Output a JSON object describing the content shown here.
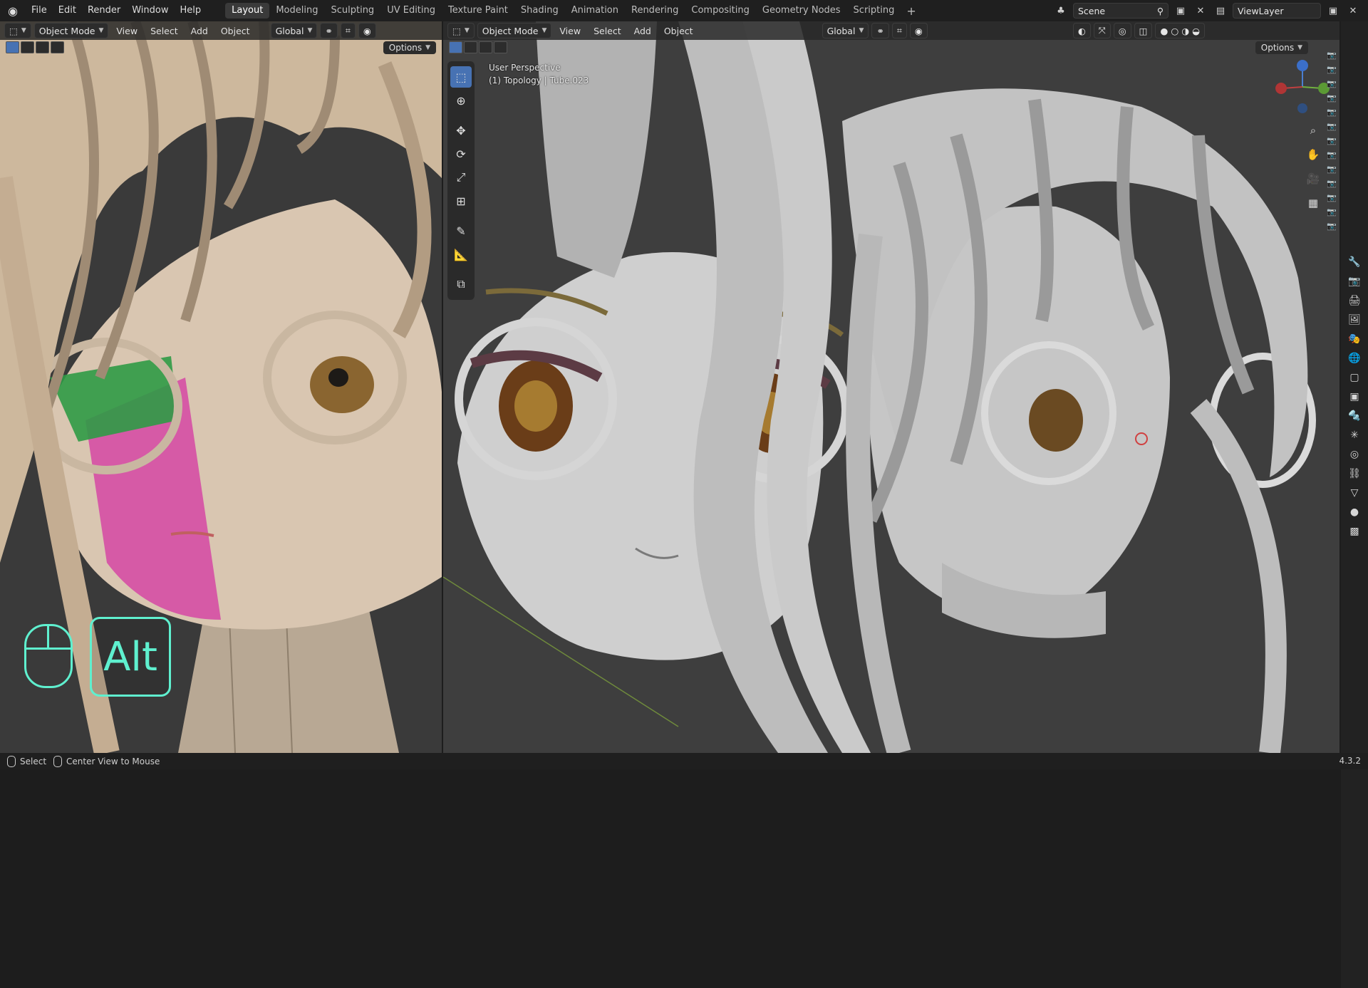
{
  "topbar": {
    "menus": [
      "File",
      "Edit",
      "Render",
      "Window",
      "Help"
    ],
    "workspaces": [
      "Layout",
      "Modeling",
      "Sculpting",
      "UV Editing",
      "Texture Paint",
      "Shading",
      "Animation",
      "Rendering",
      "Compositing",
      "Geometry Nodes",
      "Scripting"
    ],
    "active_workspace": "Layout",
    "scene": "Scene",
    "view_layer": "ViewLayer"
  },
  "left_viewport": {
    "mode": "Object Mode",
    "menus": [
      "View",
      "Select",
      "Add",
      "Object"
    ],
    "orientation": "Global",
    "options_label": "Options"
  },
  "right_viewport": {
    "mode": "Object Mode",
    "menus": [
      "View",
      "Select",
      "Add",
      "Object"
    ],
    "orientation": "Global",
    "options_label": "Options",
    "overlay_line1": "User Perspective",
    "overlay_line2": "(1) Topology | Tube.023"
  },
  "hint": {
    "key_label": "Alt"
  },
  "statusbar": {
    "select_label": "Select",
    "center_view_label": "Center View to Mouse",
    "version": "4.3.2"
  },
  "colors": {
    "accent": "#4772b3",
    "hint": "#5ff0cf",
    "viewport_bg": "#3b3b3b"
  }
}
